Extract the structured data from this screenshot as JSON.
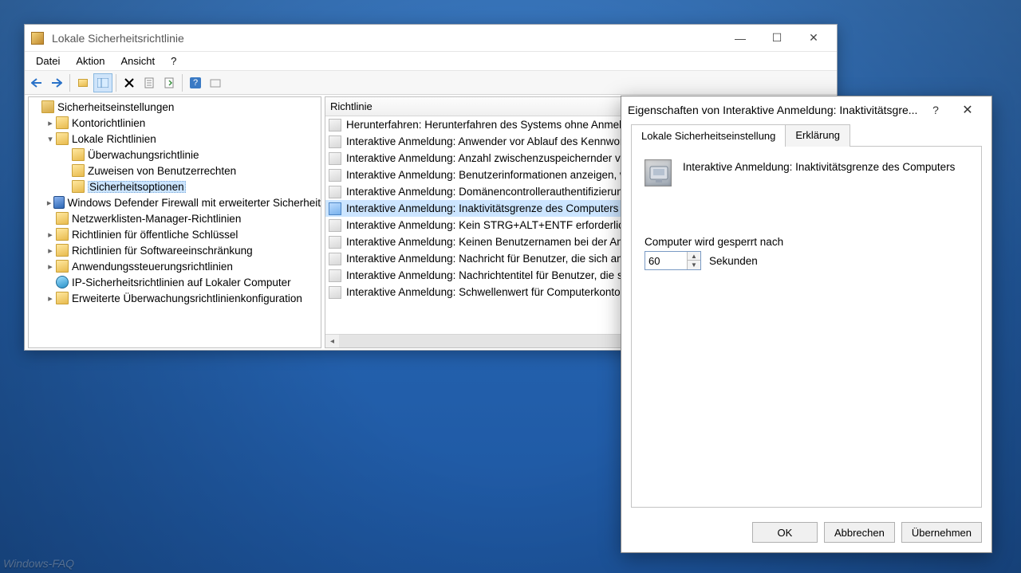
{
  "window": {
    "title": "Lokale Sicherheitsrichtlinie",
    "controls": {
      "help": "?",
      "minimize": "—",
      "maximize": "☐",
      "close": "✕"
    }
  },
  "menu": {
    "file": "Datei",
    "action": "Aktion",
    "view": "Ansicht",
    "help": "?"
  },
  "tree": {
    "root": "Sicherheitseinstellungen",
    "n0": "Kontorichtlinien",
    "n1": "Lokale Richtlinien",
    "n1a": "Überwachungsrichtlinie",
    "n1b": "Zuweisen von Benutzerrechten",
    "n1c": "Sicherheitsoptionen",
    "n2": "Windows Defender Firewall mit erweiterter Sicherheit",
    "n3": "Netzwerklisten-Manager-Richtlinien",
    "n4": "Richtlinien für öffentliche Schlüssel",
    "n5": "Richtlinien für Softwareeinschränkung",
    "n6": "Anwendungssteuerungsrichtlinien",
    "n7": "IP-Sicherheitsrichtlinien auf Lokaler Computer",
    "n8": "Erweiterte Überwachungsrichtlinienkonfiguration"
  },
  "list": {
    "header": "Richtlinie",
    "rows": [
      "Herunterfahren: Herunterfahren des Systems ohne Anmeldung zulassen",
      "Interaktive Anmeldung: Anwender vor Ablauf des Kennworts warnen",
      "Interaktive Anmeldung: Anzahl zwischenzuspeichernder vorheriger Anmeldungen",
      "Interaktive Anmeldung: Benutzerinformationen anzeigen, wenn Sitzung gesperrt",
      "Interaktive Anmeldung: Domänencontrollerauthentifizierung erforderlich",
      "Interaktive Anmeldung: Inaktivitätsgrenze des Computers",
      "Interaktive Anmeldung: Kein STRG+ALT+ENTF erforderlich",
      "Interaktive Anmeldung: Keinen Benutzernamen bei der Anmeldung anzeigen",
      "Interaktive Anmeldung: Nachricht für Benutzer, die sich anmelden wollen",
      "Interaktive Anmeldung: Nachrichtentitel für Benutzer, die sich anmelden wollen",
      "Interaktive Anmeldung: Schwellenwert für Computerkontosperrung"
    ],
    "selected_index": 5
  },
  "dialog": {
    "title": "Eigenschaften von Interaktive Anmeldung: Inaktivitätsgre...",
    "help": "?",
    "close": "✕",
    "tab_setting": "Lokale Sicherheitseinstellung",
    "tab_explain": "Erklärung",
    "policy_title": "Interaktive Anmeldung: Inaktivitätsgrenze des Computers",
    "field_label": "Computer wird gesperrt nach",
    "value": "60",
    "unit": "Sekunden",
    "ok": "OK",
    "cancel": "Abbrechen",
    "apply": "Übernehmen"
  },
  "watermark": "Windows-FAQ"
}
